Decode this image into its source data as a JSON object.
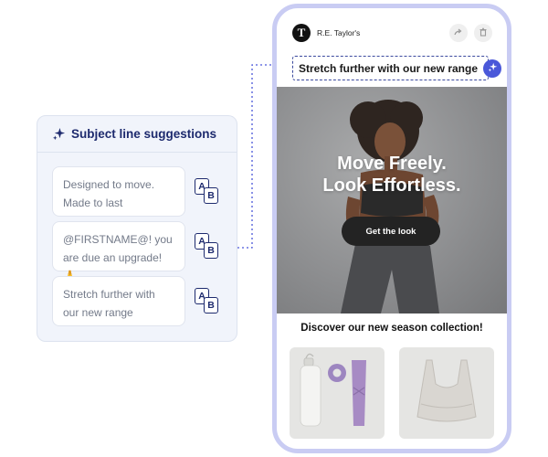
{
  "panel": {
    "title": "Subject line suggestions",
    "icon": "sparkle-icon",
    "suggestions": [
      {
        "line1": "Designed to move.",
        "line2": "Made to last"
      },
      {
        "line1": "@FIRSTNAME@! you",
        "line2": "are due an upgrade! 🙏"
      },
      {
        "line1": "Stretch further with",
        "line2": "our new range"
      }
    ],
    "ab_icon": {
      "a": "A",
      "b": "B"
    }
  },
  "email": {
    "brand_initial": "T",
    "brand_name": "R.E. Taylor's",
    "subject": "Stretch further with our new range",
    "hero": {
      "headline_line1": "Move Freely.",
      "headline_line2": "Look Effortless.",
      "cta_label": "Get the look"
    },
    "collection_title": "Discover our new season collection!"
  },
  "colors": {
    "accent": "#4a58d9",
    "navy": "#1d2a6e",
    "phone_frame": "#c9ccf3",
    "panel_bg": "#f1f4fb"
  }
}
